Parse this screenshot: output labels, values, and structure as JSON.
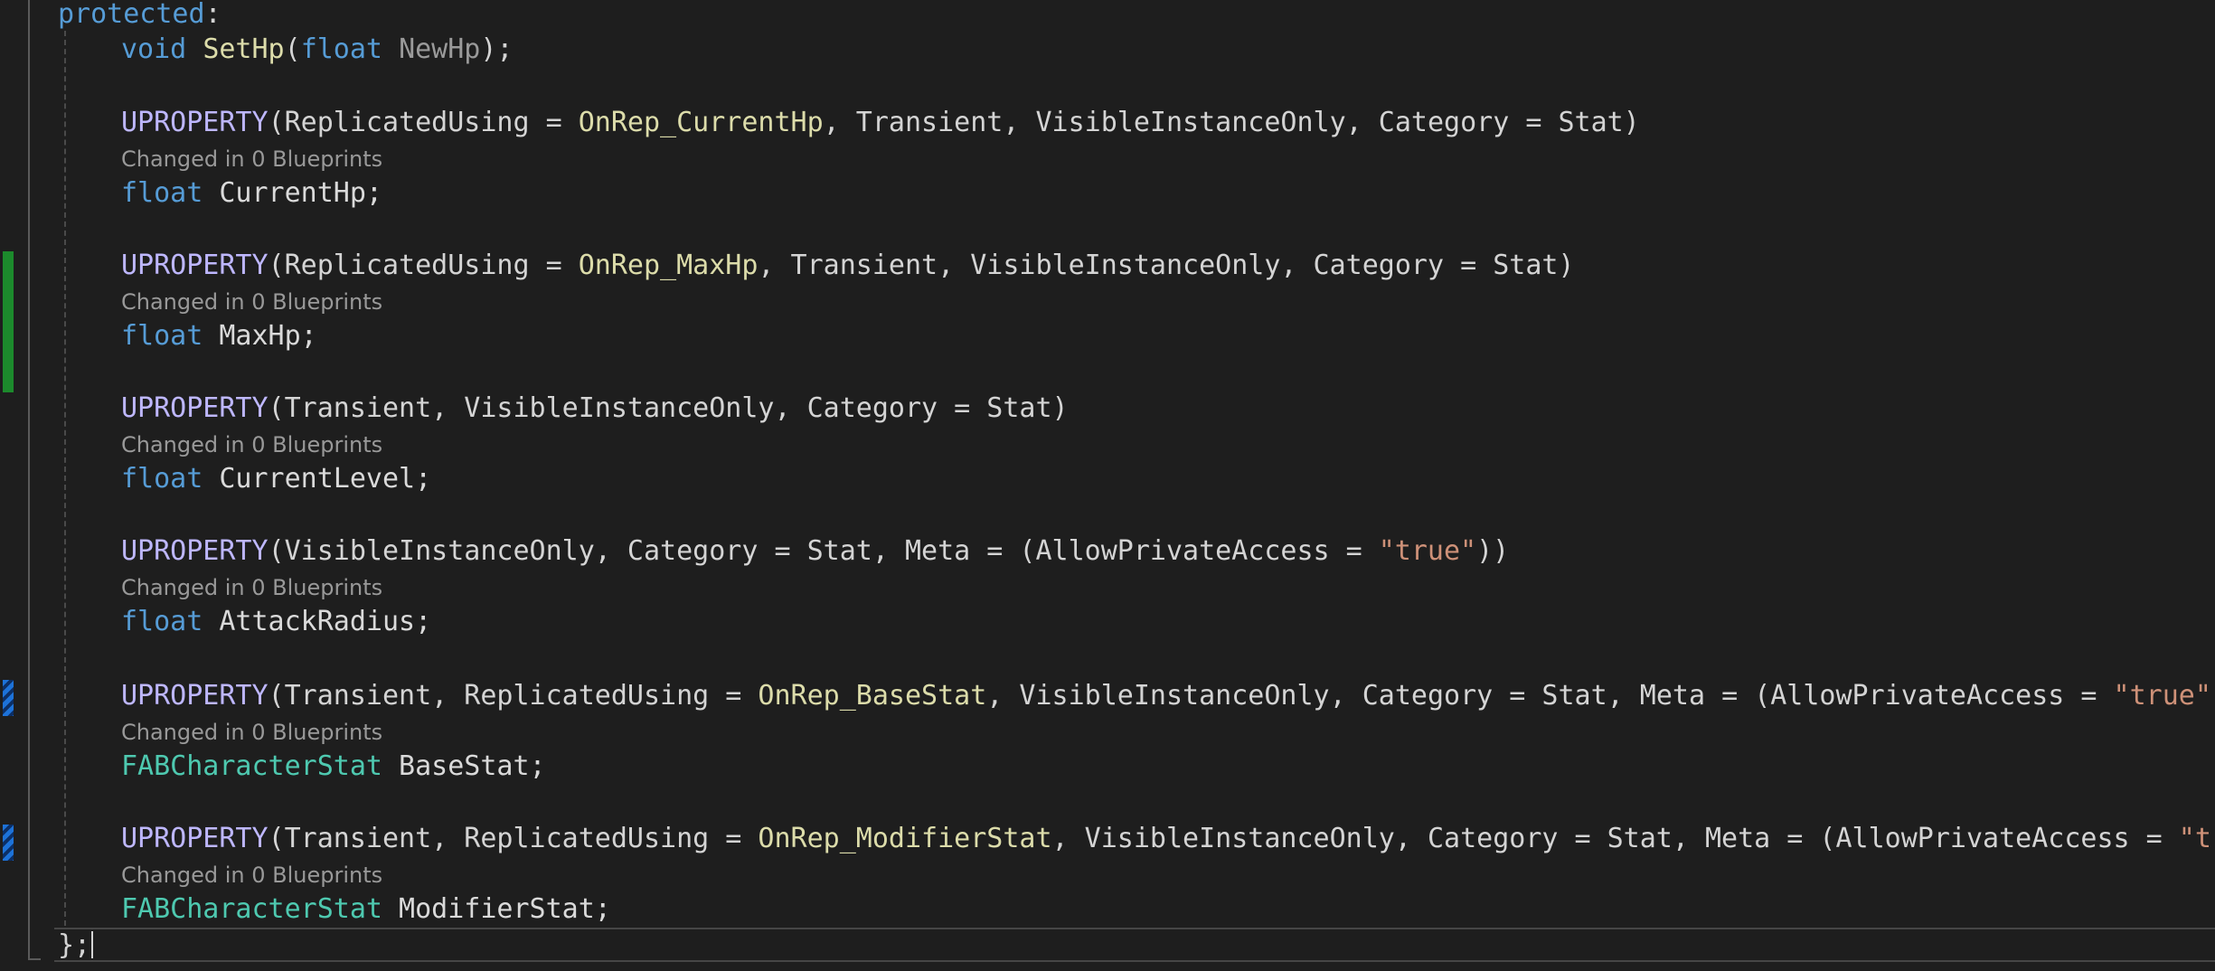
{
  "editor": {
    "lines": {
      "protected": {
        "kw": "protected",
        "colon": ":"
      },
      "sethp": {
        "ret": "void",
        "sp1": " ",
        "fn": "SetHp",
        "open": "(",
        "ptype": "float",
        "sp2": " ",
        "pname": "NewHp",
        "close": ");"
      },
      "prop_currenthp": {
        "macro": "UPROPERTY",
        "a": "(ReplicatedUsing = ",
        "fn": "OnRep_CurrentHp",
        "b": ", Transient, VisibleInstanceOnly, Category = Stat)"
      },
      "lens_1": "Changed in 0 Blueprints",
      "decl_currenthp": {
        "type": "float",
        "rest": " CurrentHp;"
      },
      "prop_maxhp": {
        "macro": "UPROPERTY",
        "a": "(ReplicatedUsing = ",
        "fn": "OnRep_MaxHp",
        "b": ", Transient, VisibleInstanceOnly, Category = Stat)"
      },
      "lens_2": "Changed in 0 Blueprints",
      "decl_maxhp": {
        "type": "float",
        "rest": " MaxHp;"
      },
      "prop_currentlevel": {
        "macro": "UPROPERTY",
        "a": "(Transient, VisibleInstanceOnly, Category = Stat)"
      },
      "lens_3": "Changed in 0 Blueprints",
      "decl_currentlevel": {
        "type": "float",
        "rest": " CurrentLevel;"
      },
      "prop_attackradius": {
        "macro": "UPROPERTY",
        "a": "(VisibleInstanceOnly, Category = Stat, Meta = (AllowPrivateAccess = ",
        "str": "\"true\"",
        "b": "))"
      },
      "lens_4": "Changed in 0 Blueprints",
      "decl_attackradius": {
        "type": "float",
        "rest": " AttackRadius;"
      },
      "prop_basestat": {
        "macro": "UPROPERTY",
        "a": "(Transient, ReplicatedUsing = ",
        "fn": "OnRep_BaseStat",
        "b": ", VisibleInstanceOnly, Category = Stat, Meta = (AllowPrivateAccess = ",
        "str": "\"true\"",
        "c": "))"
      },
      "lens_5": "Changed in 0 Blueprints",
      "decl_basestat": {
        "type": "FABCharacterStat",
        "rest": " BaseStat;"
      },
      "prop_modifierstat": {
        "macro": "UPROPERTY",
        "a": "(Transient, ReplicatedUsing = ",
        "fn": "OnRep_ModifierStat",
        "b": ", VisibleInstanceOnly, Category = Stat, Meta = (AllowPrivateAccess = ",
        "str": "\"true\"",
        "c": "))"
      },
      "lens_6": "Changed in 0 Blueprints",
      "decl_modifierstat": {
        "type": "FABCharacterStat",
        "rest": " ModifierStat;"
      },
      "closing": "};"
    }
  },
  "colors": {
    "background": "#1e1e1e",
    "keyword": "#569cd6",
    "function": "#dcdcaa",
    "macro": "#beb7ff",
    "type": "#4ec9b0",
    "string": "#ce9178",
    "codelens": "#999999",
    "change_added": "#1c8a2c",
    "change_modified": "#1d72d8"
  }
}
